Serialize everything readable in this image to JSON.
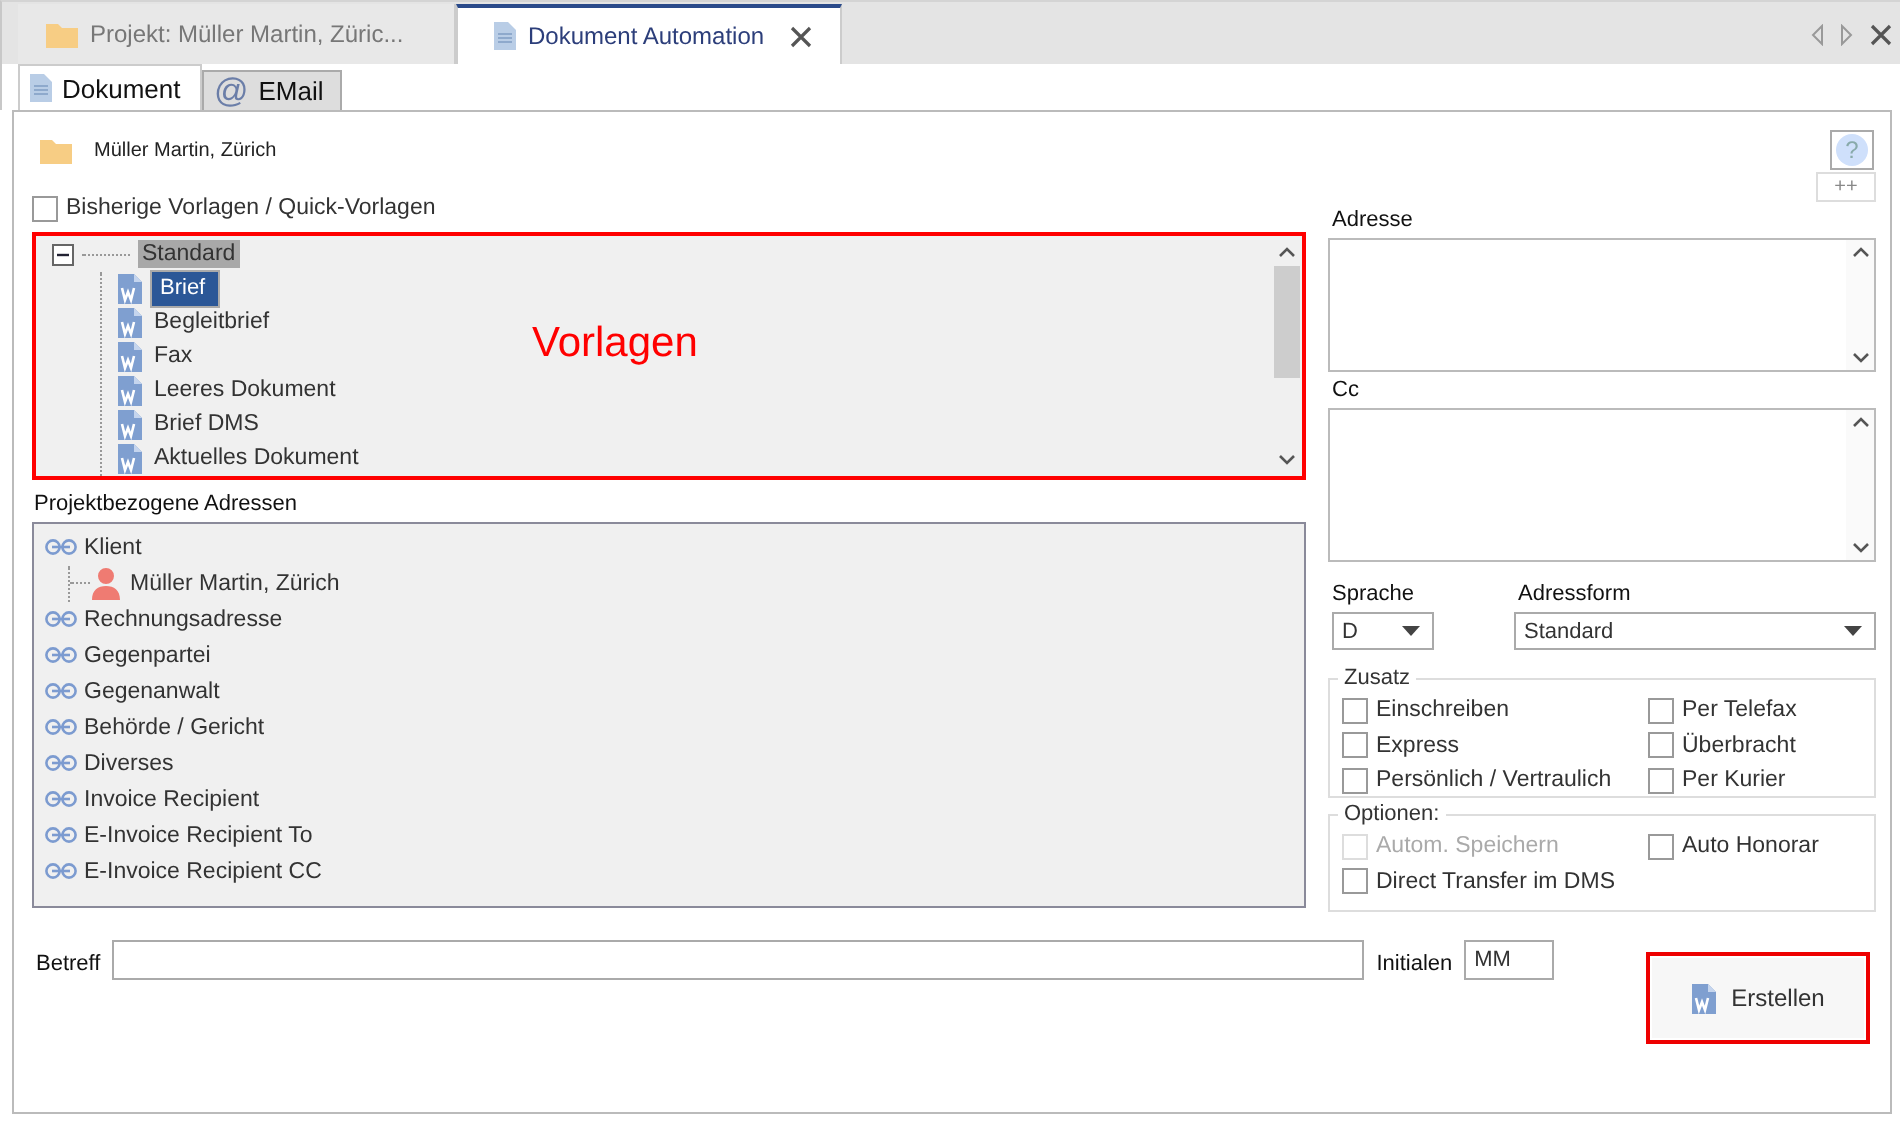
{
  "tabs": [
    {
      "label": "Projekt: Müller Martin, Züric...",
      "kind": "project",
      "selected": false,
      "closable": false
    },
    {
      "label": "Dokument Automation",
      "kind": "document",
      "selected": true,
      "closable": true
    }
  ],
  "subtabs": [
    {
      "label": "Dokument",
      "kind": "document",
      "selected": true
    },
    {
      "label": "EMail",
      "kind": "email",
      "glyph": "@",
      "selected": false
    }
  ],
  "project": {
    "name": "Müller Martin, Zürich"
  },
  "help_button": {
    "glyph": "?"
  },
  "plus_button": {
    "label": "++"
  },
  "quick_templates": {
    "label": "Bisherige Vorlagen / Quick-Vorlagen",
    "checked": false
  },
  "templates": {
    "annotation": "Vorlagen",
    "tree": [
      {
        "label": "Standard",
        "expanded": true,
        "highlighted": true,
        "children": [
          {
            "label": "Brief",
            "selected": true
          },
          {
            "label": "Begleitbrief",
            "selected": false
          },
          {
            "label": "Fax",
            "selected": false
          },
          {
            "label": "Leeres Dokument",
            "selected": false
          },
          {
            "label": "Brief DMS",
            "selected": false
          },
          {
            "label": "Aktuelles Dokument",
            "selected": false
          }
        ]
      }
    ]
  },
  "addresses": {
    "label": "Projektbezogene Adressen",
    "items": [
      {
        "label": "Klient",
        "kind": "role",
        "children": [
          {
            "label": "Müller Martin, Zürich",
            "kind": "person"
          }
        ]
      },
      {
        "label": "Rechnungsadresse",
        "kind": "role"
      },
      {
        "label": "Gegenpartei",
        "kind": "role"
      },
      {
        "label": "Gegenanwalt",
        "kind": "role"
      },
      {
        "label": "Behörde / Gericht",
        "kind": "role"
      },
      {
        "label": "Diverses",
        "kind": "role"
      },
      {
        "label": "Invoice Recipient",
        "kind": "role"
      },
      {
        "label": "E-Invoice Recipient To",
        "kind": "role"
      },
      {
        "label": "E-Invoice Recipient CC",
        "kind": "role"
      }
    ]
  },
  "address_field": {
    "label": "Adresse"
  },
  "cc_field": {
    "label": "Cc"
  },
  "language": {
    "label": "Sprache",
    "value": "D"
  },
  "address_form": {
    "label": "Adressform",
    "value": "Standard"
  },
  "zusatz": {
    "title": "Zusatz",
    "options": [
      {
        "label": "Einschreiben",
        "checked": false,
        "disabled": false
      },
      {
        "label": "Per Telefax",
        "checked": false,
        "disabled": false
      },
      {
        "label": "Express",
        "checked": false,
        "disabled": false
      },
      {
        "label": "Überbracht",
        "checked": false,
        "disabled": false
      },
      {
        "label": "Persönlich / Vertraulich",
        "checked": false,
        "disabled": false
      },
      {
        "label": "Per Kurier",
        "checked": false,
        "disabled": false
      }
    ]
  },
  "optionen": {
    "title": "Optionen:",
    "options": [
      {
        "label": "Autom. Speichern",
        "checked": false,
        "disabled": true
      },
      {
        "label": "Auto Honorar",
        "checked": false,
        "disabled": false
      },
      {
        "label": "Direct Transfer im DMS",
        "checked": false,
        "disabled": false
      }
    ]
  },
  "subject": {
    "label": "Betreff"
  },
  "initials": {
    "label": "Initialen",
    "value": "MM"
  },
  "create_button": {
    "label": "Erstellen"
  }
}
